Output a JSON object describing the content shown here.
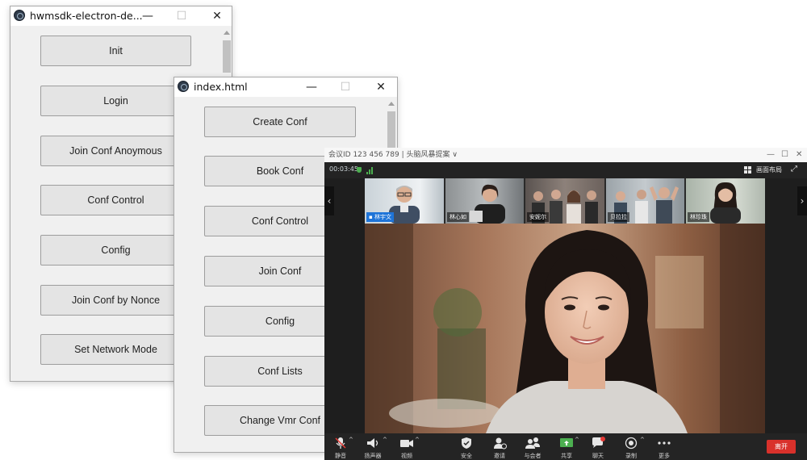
{
  "window1": {
    "title": "hwmsdk-electron-de...",
    "minimize": "—",
    "maximize": "☐",
    "close": "✕",
    "buttons": [
      "Init",
      "Login",
      "Join Conf Anoymous",
      "Conf Control",
      "Config",
      "Join Conf by Nonce",
      "Set Network Mode"
    ]
  },
  "window2": {
    "title": "index.html",
    "minimize": "—",
    "maximize": "☐",
    "close": "✕",
    "buttons": [
      "Create Conf",
      "Book Conf",
      "Conf Control",
      "Join Conf",
      "Config",
      "Conf Lists",
      "Change Vmr Conf"
    ]
  },
  "conference": {
    "title": "会议ID 123 456 789 | 头脑风暴提案 ∨",
    "win_minimize": "—",
    "win_maximize": "☐",
    "win_close": "✕",
    "timer": "00:03:45",
    "layout_label": "画面布局",
    "expand_icon": "⤢",
    "nav_left": "‹",
    "nav_right": "›",
    "participants": [
      "林宇文",
      "林心如",
      "安妮尔",
      "贝拉拉",
      "林珍珠"
    ],
    "toolbar": {
      "mute": "静音",
      "speaker": "扬声器",
      "video": "视频",
      "security": "安全",
      "invite": "邀请",
      "participants": "与会者",
      "share": "共享",
      "chat": "聊天",
      "record": "录制",
      "more": "更多",
      "leave": "离开"
    },
    "colors": {
      "leave": "#d9312b",
      "share": "#4caf50",
      "chat_badge": "#e53935"
    }
  }
}
